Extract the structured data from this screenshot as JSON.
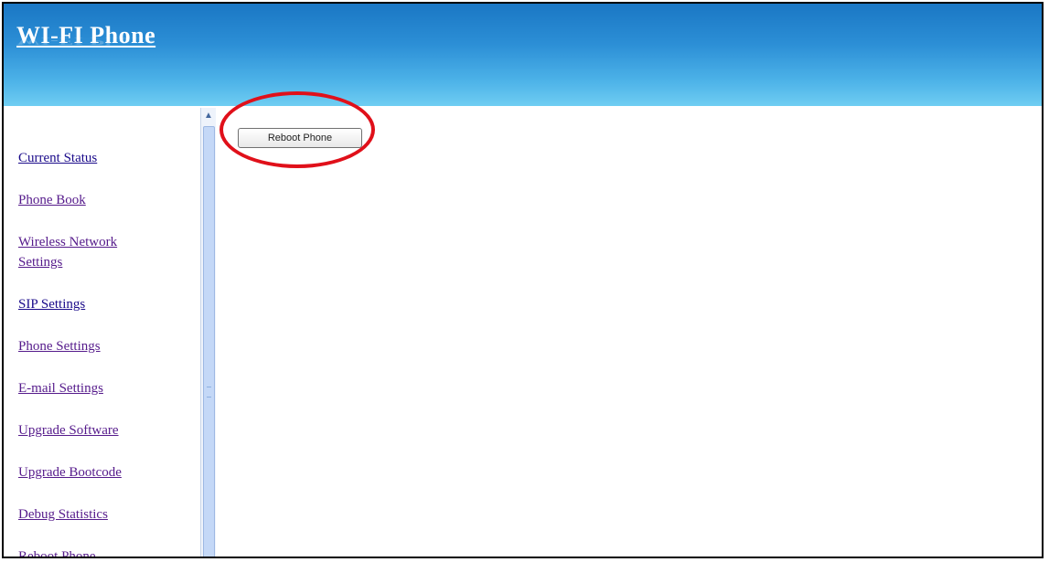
{
  "header": {
    "title": "WI-FI Phone"
  },
  "sidebar": {
    "items": [
      {
        "label": "Current Status",
        "visited": false
      },
      {
        "label": "Phone Book",
        "visited": true
      },
      {
        "label": "Wireless Network Settings",
        "visited": true
      },
      {
        "label": "SIP Settings",
        "visited": false
      },
      {
        "label": "Phone Settings",
        "visited": true
      },
      {
        "label": "E-mail Settings",
        "visited": true
      },
      {
        "label": "Upgrade Software",
        "visited": true
      },
      {
        "label": "Upgrade Bootcode",
        "visited": true
      },
      {
        "label": "Debug Statistics",
        "visited": true
      },
      {
        "label": "Reboot Phone",
        "visited": true
      }
    ]
  },
  "main": {
    "reboot_button_label": "Reboot Phone"
  },
  "colors": {
    "annotation_circle": "#e0101a",
    "link": "#1a0a8a",
    "visited_link": "#551a8b"
  }
}
